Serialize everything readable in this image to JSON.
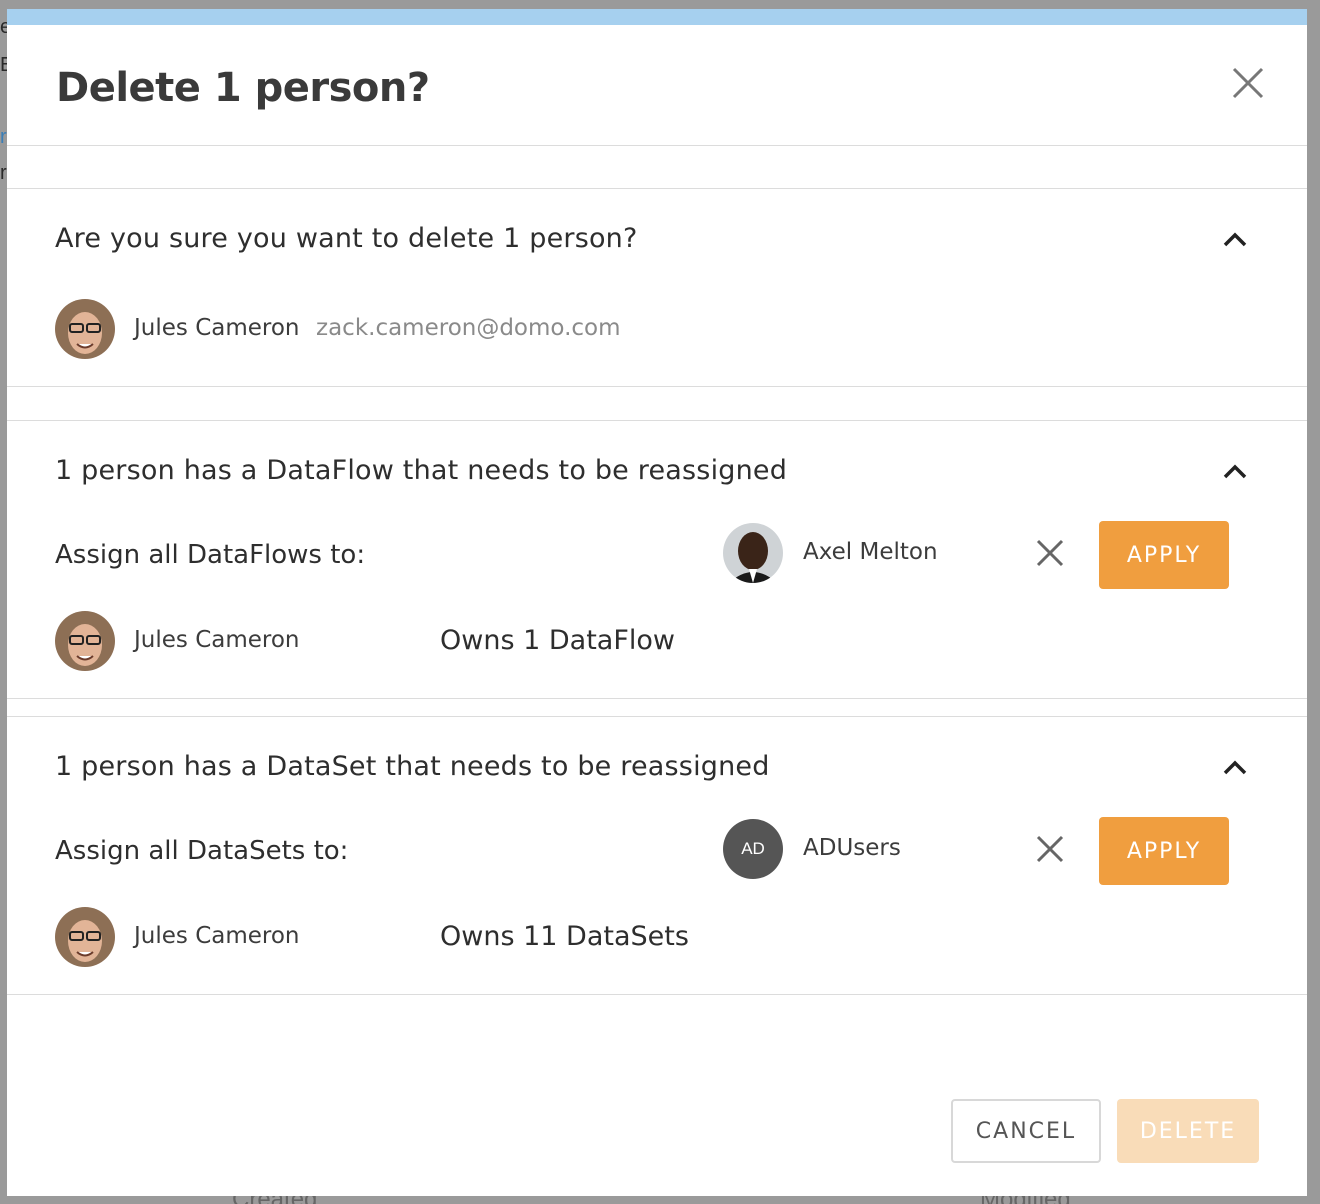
{
  "background": {
    "fragments": [
      "e",
      "E",
      "r",
      "r"
    ],
    "bottom_left": "Created",
    "bottom_right": "Modified"
  },
  "dialog": {
    "title": "Delete 1 person?",
    "close_icon": "close-icon",
    "accent_color": "#a6d0ef"
  },
  "confirm_section": {
    "title": "Are you sure you want to delete 1 person?",
    "person": {
      "name": "Jules Cameron",
      "email": "zack.cameron@domo.com"
    }
  },
  "dataflow_section": {
    "title": "1 person has a DataFlow that needs to be reassigned",
    "assign_label": "Assign all DataFlows to:",
    "assignee": {
      "name": "Axel Melton"
    },
    "apply_label": "APPLY",
    "owner": {
      "name": "Jules Cameron",
      "owns": "Owns 1 DataFlow"
    }
  },
  "dataset_section": {
    "title": "1 person has a DataSet that needs to be reassigned",
    "assign_label": "Assign all DataSets to:",
    "assignee": {
      "name": "ADUsers",
      "initials": "AD"
    },
    "apply_label": "APPLY",
    "owner": {
      "name": "Jules Cameron",
      "owns": "Owns 11 DataSets"
    }
  },
  "footer": {
    "cancel_label": "CANCEL",
    "delete_label": "DELETE"
  },
  "colors": {
    "apply": "#f09e3f",
    "delete_disabled": "#f9dcb8"
  }
}
